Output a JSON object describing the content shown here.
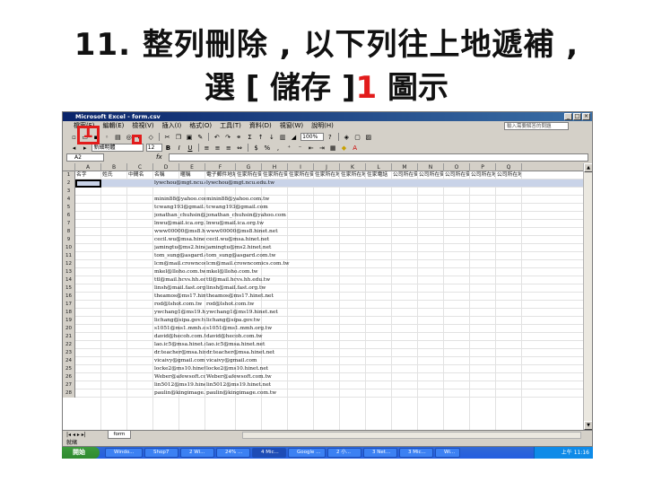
{
  "slide": {
    "title_line1": "11. 整列刪除 , 以下列往上地遞補 ,",
    "title_line2_a": "選 [ 儲存 ]",
    "title_line2_num": "1",
    "title_line2_b": " 圖示",
    "marker_label": "1",
    "accent_color": "#e21c1c"
  },
  "excel": {
    "window_title": "Microsoft Excel - form.csv",
    "menus": [
      "檔案(F)",
      "編輯(E)",
      "檢視(V)",
      "插入(I)",
      "格式(O)",
      "工具(T)",
      "資料(D)",
      "視窗(W)",
      "說明(H)"
    ],
    "help_placeholder": "輸入需要解答的問題",
    "zoom": "100%",
    "reviewer_label": "以變更回覆(Y)... 結束校閱(N)...",
    "font_name": "新細明體",
    "font_size": "12",
    "name_box": "A2",
    "fx_symbol": "fx",
    "columns": [
      "A",
      "B",
      "C",
      "D",
      "E",
      "F",
      "G",
      "H",
      "I",
      "J",
      "K",
      "L",
      "M",
      "N",
      "O",
      "P",
      "Q"
    ],
    "header_row": [
      "名字",
      "姓氏",
      "中間名",
      "名稱",
      "暱稱",
      "電子郵件地址",
      "住家所在街道",
      "住家所在街道 2",
      "住家所在街道 3",
      "住家所在地市",
      "住家所在地郵遞區號",
      "住家電話",
      "公司所在街道",
      "公司所在街道 2",
      "公司所在街道 3",
      "公司所在地市",
      "公司所在地"
    ],
    "rows": [
      [
        "lywchou@mgt.ncu.edu.tw",
        "lywchou@mgt.ncu.edu.tw"
      ],
      [
        "",
        ""
      ],
      [
        "minin88@yahoo.com.tw",
        "minin88@yahoo.com.tw"
      ],
      [
        "tcwang193@gmail.com",
        "tcwang193@gmail.com"
      ],
      [
        "jonathan_chuhsin@yahoo.com",
        "jonathan_chuhsin@yahoo.com"
      ],
      [
        "lnwu@mail.ica.org.tw",
        "lnwu@mail.ica.org.tw"
      ],
      [
        "www00000@ms8.hinet.net",
        "www00000@ms8.hinet.net"
      ],
      [
        "cecil.wu@msa.hinet.net",
        "cecil.wu@msa.hinet.net"
      ],
      [
        "jamingtu@ms2.hinet.net",
        "jamingtu@ms2.hinet.net"
      ],
      [
        "tom_sung@asgard.com.tw",
        "tom_sung@asgard.com.tw"
      ],
      [
        "lcm@mail.crowncomics.com.tw",
        "lcm@mail.crowncomics.com.tw"
      ],
      [
        "mkel@lloho.com.tw",
        "mkel@lloho.com.tw"
      ],
      [
        "ttl@mail.hcvs.hh.edu.tw",
        "ttl@mail.hcvs.hh.edu.tw"
      ],
      [
        "linsh@mail.fast.org.tw",
        "linsh@mail.fast.org.tw"
      ],
      [
        "theamos@ms17.hinet.net",
        "theamos@ms17.hinet.net"
      ],
      [
        "rod@lshot.com.tw",
        "rod@lshot.com.tw"
      ],
      [
        "ywchang1@ms19.hinet.net",
        "ywchang1@ms19.hinet.net"
      ],
      [
        "lichang@sipa.gov.tw",
        "lichang@sipa.gov.tw"
      ],
      [
        "s1051@ms1.mmh.org.tw",
        "s1051@ms1.mmh.org.tw"
      ],
      [
        "david@hecoh.com.tw",
        "david@hecoh.com.tw"
      ],
      [
        "lao.ic5@msa.hinet.net",
        "lao.ic5@msa.hinet.net"
      ],
      [
        "dr.teacher@msa.hinet.net",
        "dr.teacher@msa.hinet.net"
      ],
      [
        "vicaivy@gmail.com",
        "vicaivy@gmail.com"
      ],
      [
        "locke2@ms10.hinet.net",
        "locke2@ms10.hinet.net"
      ],
      [
        "Weber@afewsoft.com.tw",
        "Weber@afewsoft.com.tw"
      ],
      [
        "lin5012@ms19.hinet.net",
        "lin5012@ms19.hinet.net"
      ],
      [
        "paulin@kingimage.com.tw",
        "paulin@kingimage.com.tw"
      ]
    ],
    "sheet_tab": "form",
    "status": "就緒"
  },
  "taskbar": {
    "start_label": "開始",
    "tasks": [
      "Windo...",
      "Shop7",
      "2 Wi...",
      "24% ...",
      "4 Mic...",
      "Google ...",
      "2 小...",
      "3 Net...",
      "3 Mic...",
      "Wi..."
    ],
    "active_task": "4 Mic...",
    "clock": "上午 11:16"
  }
}
